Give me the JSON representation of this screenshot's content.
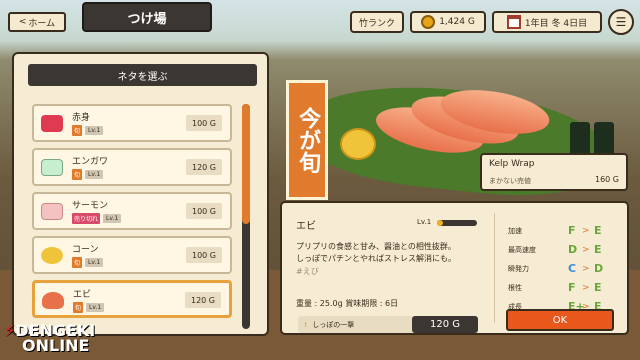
{
  "topbar": {
    "home_label": "ホーム",
    "title": "つけ場",
    "rank_label": "竹ランク",
    "gold": "1,424 G",
    "date": "1年目 冬 4日目"
  },
  "list": {
    "header": "ネタを選ぶ",
    "items": [
      {
        "name": "赤身",
        "tag": "旬",
        "lv": "Lv.1",
        "price": "100 G",
        "color": "#e03a52"
      },
      {
        "name": "エンガワ",
        "tag": "旬",
        "lv": "Lv.1",
        "price": "120 G",
        "color": "#c8eed0"
      },
      {
        "name": "サーモン",
        "tag": "売り切れ",
        "lv": "Lv.1",
        "price": "100 G",
        "color": "#f4c2c2"
      },
      {
        "name": "コーン",
        "tag": "旬",
        "lv": "Lv.1",
        "price": "100 G",
        "color": "#f0c43a"
      },
      {
        "name": "エビ",
        "tag": "旬",
        "lv": "Lv.1",
        "price": "120 G",
        "color": "#e8704a"
      }
    ]
  },
  "banner": {
    "text": "今が旬"
  },
  "kelp": {
    "title": "Kelp Wrap",
    "sub": "まかない売値",
    "price": "160 G"
  },
  "detail": {
    "name": "エビ",
    "lv": "Lv.1",
    "lv_fraction": 0.15,
    "desc1": "プリプリの食感と甘み、醤油との相性抜群。",
    "desc2": "しっぽでパチンとやればストレス解消にも。",
    "hashtag": "#えび",
    "weight": "重量 : 25.0g 賞味期限 : 6日",
    "skill_mark": "!",
    "skill": "しっぽの一撃",
    "skill_price": "120 G",
    "stats": [
      {
        "label": "加速",
        "from": "F",
        "to": "E",
        "from_color": "#6aa63a",
        "to_color": "#6aa63a"
      },
      {
        "label": "最高速度",
        "from": "D",
        "to": "E",
        "from_color": "#6aa63a",
        "to_color": "#6aa63a"
      },
      {
        "label": "瞬発力",
        "from": "C",
        "to": "D",
        "from_color": "#3a8adc",
        "to_color": "#6aa63a"
      },
      {
        "label": "根性",
        "from": "F",
        "to": "E",
        "from_color": "#6aa63a",
        "to_color": "#6aa63a"
      },
      {
        "label": "成長",
        "from": "E+",
        "to": "E",
        "from_color": "#6aa63a",
        "to_color": "#6aa63a"
      }
    ],
    "ok_label": "OK"
  },
  "watermark": {
    "line1": "DENGEKI",
    "line2": "ONLINE"
  }
}
